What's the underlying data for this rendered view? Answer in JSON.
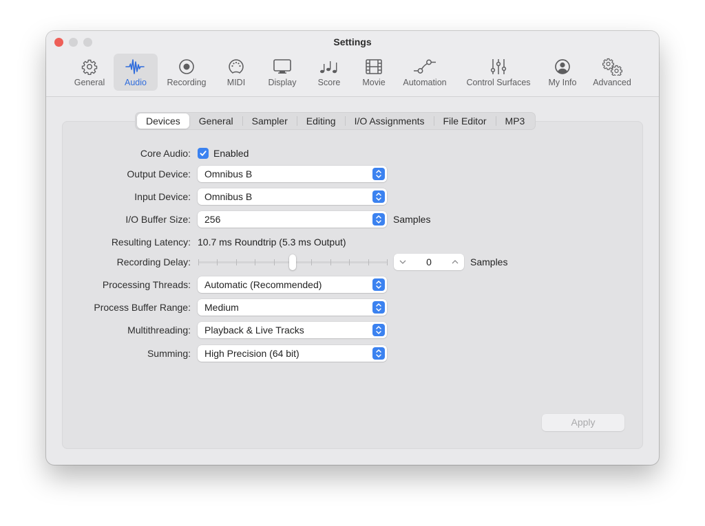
{
  "window": {
    "title": "Settings"
  },
  "toolbar": {
    "selected": "Audio",
    "items": [
      {
        "label": "General",
        "icon": "gear-icon"
      },
      {
        "label": "Audio",
        "icon": "waveform-icon"
      },
      {
        "label": "Recording",
        "icon": "record-icon"
      },
      {
        "label": "MIDI",
        "icon": "midi-port-icon"
      },
      {
        "label": "Display",
        "icon": "monitor-icon"
      },
      {
        "label": "Score",
        "icon": "music-notes-icon"
      },
      {
        "label": "Movie",
        "icon": "film-icon"
      },
      {
        "label": "Automation",
        "icon": "automation-curve-icon"
      },
      {
        "label": "Control Surfaces",
        "icon": "sliders-icon"
      },
      {
        "label": "My Info",
        "icon": "person-circle-icon"
      },
      {
        "label": "Advanced",
        "icon": "gears-icon"
      }
    ]
  },
  "tabs": {
    "active": "Devices",
    "items": [
      "Devices",
      "General",
      "Sampler",
      "Editing",
      "I/O Assignments",
      "File Editor",
      "MP3"
    ]
  },
  "form": {
    "core_audio": {
      "label": "Core Audio:",
      "checkbox_label": "Enabled",
      "checked": true
    },
    "output_device": {
      "label": "Output Device:",
      "value": "Omnibus B"
    },
    "input_device": {
      "label": "Input Device:",
      "value": "Omnibus B"
    },
    "io_buffer_size": {
      "label": "I/O Buffer Size:",
      "value": "256",
      "unit": "Samples"
    },
    "resulting_latency": {
      "label": "Resulting Latency:",
      "value": "10.7 ms Roundtrip (5.3 ms Output)"
    },
    "recording_delay": {
      "label": "Recording Delay:",
      "value": "0",
      "unit": "Samples",
      "slider_position_fraction": 0.5,
      "tick_count": 11
    },
    "processing_threads": {
      "label": "Processing Threads:",
      "value": "Automatic (Recommended)"
    },
    "process_buffer_range": {
      "label": "Process Buffer Range:",
      "value": "Medium"
    },
    "multithreading": {
      "label": "Multithreading:",
      "value": "Playback & Live Tracks"
    },
    "summing": {
      "label": "Summing:",
      "value": "High Precision (64 bit)"
    }
  },
  "footer": {
    "apply_label": "Apply",
    "apply_enabled": false
  },
  "colors": {
    "accent": "#3b82f0",
    "selected_tab_text": "#2f6cdc",
    "close_button": "#ee5f58"
  }
}
